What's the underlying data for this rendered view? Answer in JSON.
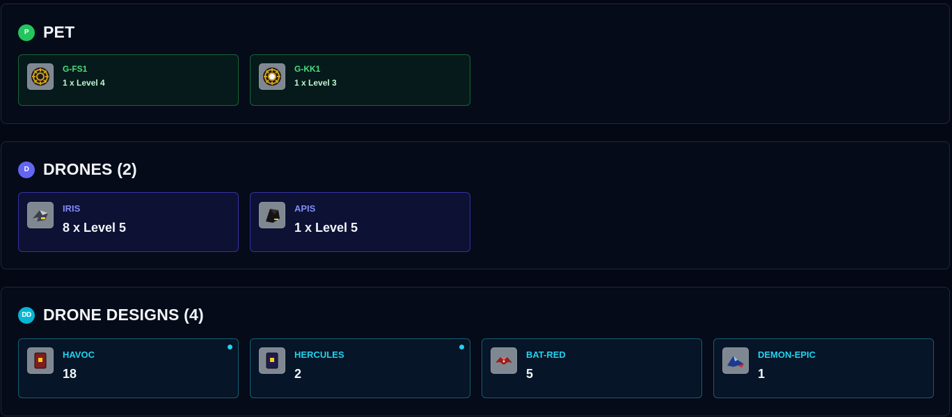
{
  "colors": {
    "pet_accent": "#22c55e",
    "drones_accent": "#6366f1",
    "designs_accent": "#06b6d4",
    "background": "#040814"
  },
  "pet": {
    "badge": "P",
    "title": "PET",
    "items": [
      {
        "name": "G-FS1",
        "value": "1 x Level 4",
        "icon": "gear-module-icon"
      },
      {
        "name": "G-KK1",
        "value": "1 x Level 3",
        "icon": "gear-module-icon"
      }
    ]
  },
  "drones": {
    "badge": "D",
    "title": "DRONES (2)",
    "items": [
      {
        "name": "IRIS",
        "value": "8 x Level 5",
        "icon": "iris-drone-icon"
      },
      {
        "name": "APIS",
        "value": "1 x Level 5",
        "icon": "apis-drone-icon"
      }
    ]
  },
  "designs": {
    "badge": "DD",
    "title": "DRONE DESIGNS (4)",
    "items": [
      {
        "name": "HAVOC",
        "value": "18",
        "icon": "havoc-card-icon",
        "has_dot": true
      },
      {
        "name": "HERCULES",
        "value": "2",
        "icon": "hercules-card-icon",
        "has_dot": true
      },
      {
        "name": "BAT-RED",
        "value": "5",
        "icon": "bat-red-design-icon",
        "has_dot": false
      },
      {
        "name": "DEMON-EPIC",
        "value": "1",
        "icon": "demon-epic-design-icon",
        "has_dot": false
      }
    ]
  }
}
